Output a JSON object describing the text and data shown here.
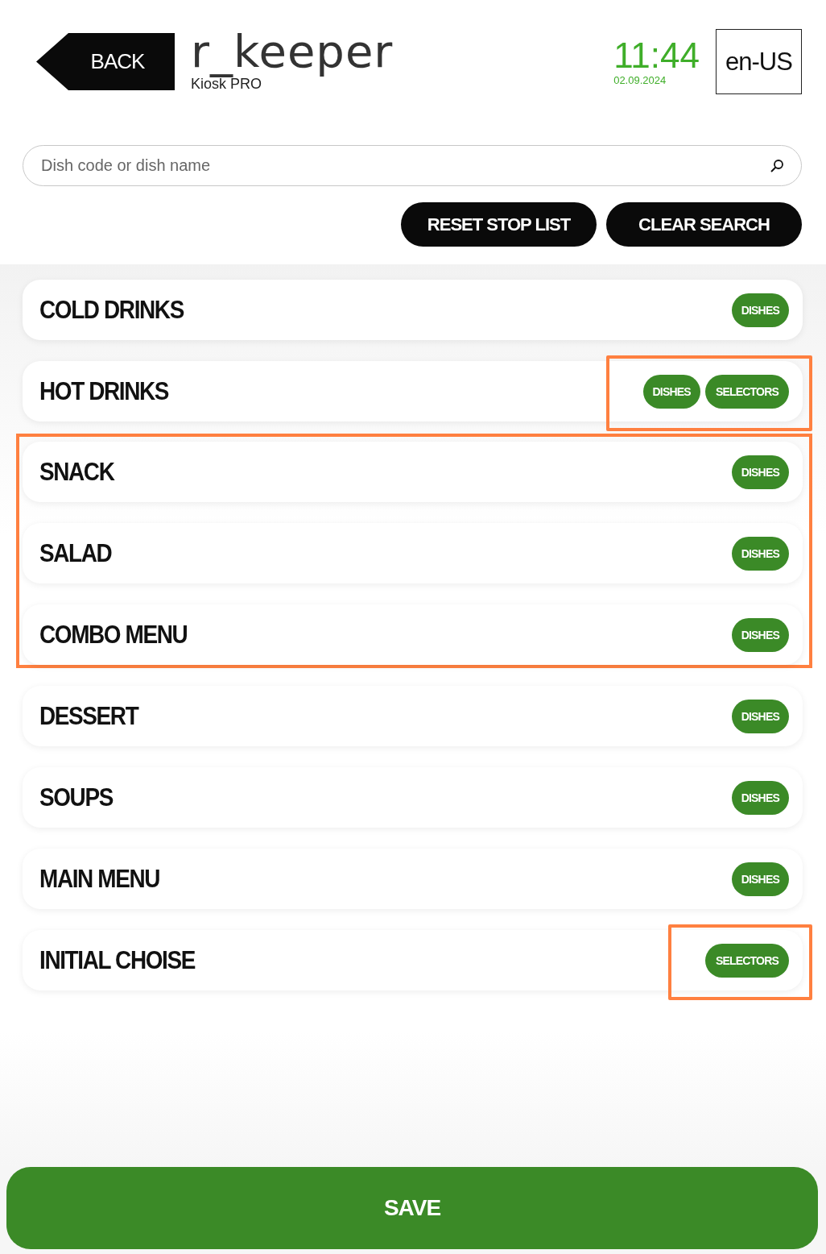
{
  "header": {
    "back": "BACK",
    "logo": "r_keeper",
    "subtitle": "Kiosk PRO",
    "time": "11:44",
    "date": "02.09.2024",
    "language": "en-US"
  },
  "search": {
    "placeholder": "Dish code or dish name"
  },
  "actions": [
    "RESET STOP LIST",
    "CLEAR SEARCH"
  ],
  "category_groups": [
    {
      "highlighted": false,
      "items": [
        {
          "name": "COLD DRINKS",
          "buttons_highlighted": false,
          "buttons": [
            {
              "kind": "dishes",
              "label": "DISHES"
            }
          ]
        },
        {
          "name": "HOT DRINKS",
          "buttons_highlighted": true,
          "buttons": [
            {
              "kind": "dishes",
              "label": "DISHES"
            },
            {
              "kind": "selectors",
              "label": "SELECTORS"
            }
          ]
        }
      ]
    },
    {
      "highlighted": true,
      "items": [
        {
          "name": "SNACK",
          "buttons_highlighted": false,
          "buttons": [
            {
              "kind": "dishes",
              "label": "DISHES"
            }
          ]
        },
        {
          "name": "SALAD",
          "buttons_highlighted": false,
          "buttons": [
            {
              "kind": "dishes",
              "label": "DISHES"
            }
          ]
        },
        {
          "name": "COMBO MENU",
          "buttons_highlighted": false,
          "buttons": [
            {
              "kind": "dishes",
              "label": "DISHES"
            }
          ]
        }
      ]
    },
    {
      "highlighted": false,
      "items": [
        {
          "name": "DESSERT",
          "buttons_highlighted": false,
          "buttons": [
            {
              "kind": "dishes",
              "label": "DISHES"
            }
          ]
        },
        {
          "name": "SOUPS",
          "buttons_highlighted": false,
          "buttons": [
            {
              "kind": "dishes",
              "label": "DISHES"
            }
          ]
        },
        {
          "name": "MAIN MENU",
          "buttons_highlighted": false,
          "buttons": [
            {
              "kind": "dishes",
              "label": "DISHES"
            }
          ]
        },
        {
          "name": "INITIAL CHOISE",
          "buttons_highlighted": true,
          "buttons": [
            {
              "kind": "selectors",
              "label": "SELECTORS"
            }
          ]
        }
      ]
    }
  ],
  "save": "SAVE"
}
